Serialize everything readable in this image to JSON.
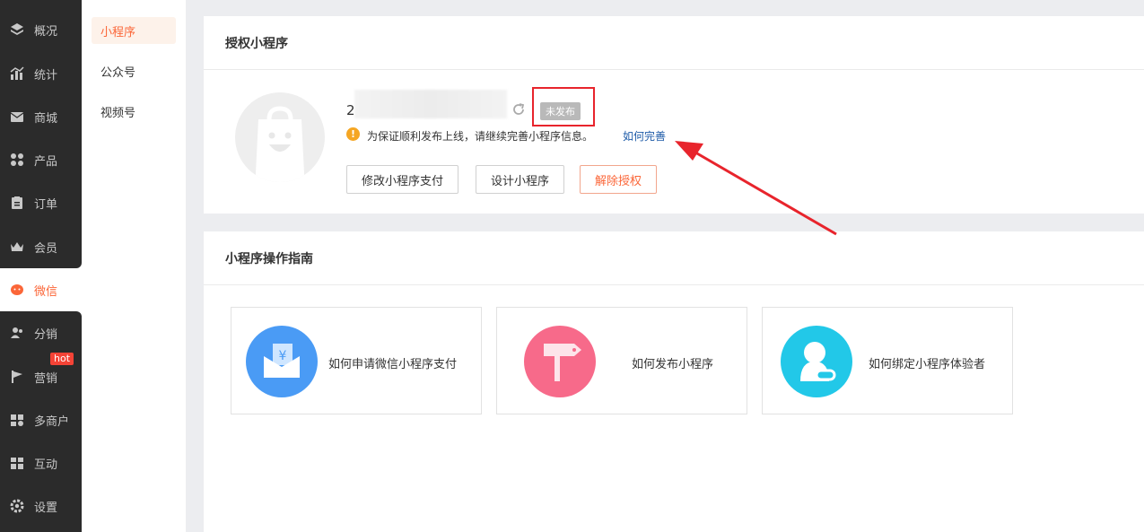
{
  "nav": {
    "items": [
      {
        "label": "概况",
        "icon": "layers-icon"
      },
      {
        "label": "统计",
        "icon": "chart-icon"
      },
      {
        "label": "商城",
        "icon": "envelope-icon"
      },
      {
        "label": "产品",
        "icon": "grid-icon"
      },
      {
        "label": "订单",
        "icon": "clipboard-icon"
      },
      {
        "label": "会员",
        "icon": "crown-icon"
      },
      {
        "label": "微信",
        "icon": "wechat-icon"
      },
      {
        "label": "分销",
        "icon": "users-icon"
      },
      {
        "label": "营销",
        "icon": "flag-icon"
      },
      {
        "label": "多商户",
        "icon": "store-icon"
      },
      {
        "label": "互动",
        "icon": "people-icon"
      },
      {
        "label": "设置",
        "icon": "gear-icon"
      }
    ],
    "hot_badge": "hot",
    "active_color": "#fb6638"
  },
  "subnav": {
    "items": [
      "小程序",
      "公众号",
      "视频号"
    ]
  },
  "auth_card": {
    "title": "授权小程序",
    "app_name": "2",
    "status": "未发布",
    "warning": "为保证顺利发布上线，请继续完善小程序信息。",
    "warning_link": "如何完善",
    "buttons": {
      "pay": "修改小程序支付",
      "design": "设计小程序",
      "unbind": "解除授权"
    }
  },
  "guide_card": {
    "title": "小程序操作指南",
    "items": [
      {
        "label": "如何申请微信小程序支付",
        "icon": "wallet-icon",
        "color": "#4a9bf5"
      },
      {
        "label": "如何发布小程序",
        "icon": "signpost-icon",
        "color": "#f76a8a"
      },
      {
        "label": "如何绑定小程序体验者",
        "icon": "user-link-icon",
        "color": "#22c8e8"
      }
    ]
  }
}
